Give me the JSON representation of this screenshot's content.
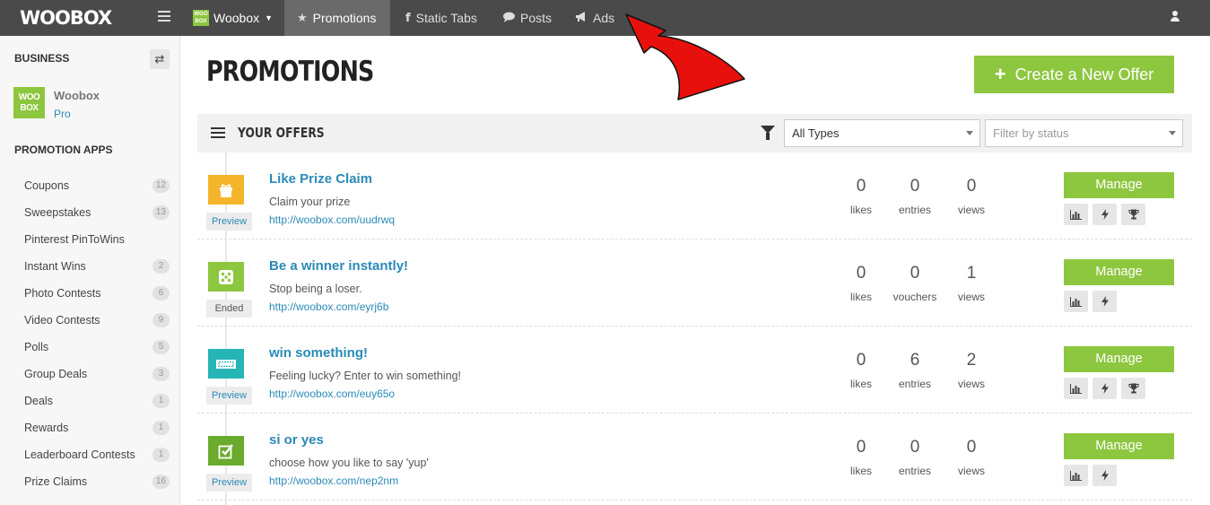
{
  "topbar": {
    "logo": "WOOBOX",
    "brand_mini": "WOO BOX",
    "brand_label": "Woobox",
    "nav": [
      {
        "label": "Promotions",
        "icon": "star-icon"
      },
      {
        "label": "Static Tabs",
        "icon": "facebook-icon"
      },
      {
        "label": "Posts",
        "icon": "speech-bubble-icon"
      },
      {
        "label": "Ads",
        "icon": "megaphone-icon"
      }
    ]
  },
  "sidebar": {
    "business_heading": "BUSINESS",
    "business_logo": "WOO BOX",
    "business_name": "Woobox",
    "business_plan": "Pro",
    "apps_heading": "PROMOTION APPS",
    "items": [
      {
        "label": "Coupons",
        "count": "12"
      },
      {
        "label": "Sweepstakes",
        "count": "13"
      },
      {
        "label": "Pinterest PinToWins",
        "count": ""
      },
      {
        "label": "Instant Wins",
        "count": "2"
      },
      {
        "label": "Photo Contests",
        "count": "6"
      },
      {
        "label": "Video Contests",
        "count": "9"
      },
      {
        "label": "Polls",
        "count": "5"
      },
      {
        "label": "Group Deals",
        "count": "3"
      },
      {
        "label": "Deals",
        "count": "1"
      },
      {
        "label": "Rewards",
        "count": "1"
      },
      {
        "label": "Leaderboard Contests",
        "count": "1"
      },
      {
        "label": "Prize Claims",
        "count": "16"
      }
    ]
  },
  "main": {
    "title": "PROMOTIONS",
    "create_button": "Create a New Offer",
    "offers_heading": "YOUR OFFERS",
    "type_select": "All Types",
    "status_placeholder": "Filter by status"
  },
  "offers": [
    {
      "title": "Like Prize Claim",
      "desc": "Claim your prize",
      "link": "http://woobox.com/uudrwq",
      "status": "Preview",
      "icon": "gift-icon",
      "color": "#f5b52a",
      "stats": [
        {
          "num": "0",
          "lbl": "likes"
        },
        {
          "num": "0",
          "lbl": "entries"
        },
        {
          "num": "0",
          "lbl": "views"
        }
      ],
      "manage": "Manage"
    },
    {
      "title": "Be a winner instantly!",
      "desc": "Stop being a loser.",
      "link": "http://woobox.com/eyrj6b",
      "status": "Ended",
      "icon": "dice-icon",
      "color": "#8dc63f",
      "stats": [
        {
          "num": "0",
          "lbl": "likes"
        },
        {
          "num": "0",
          "lbl": "vouchers"
        },
        {
          "num": "1",
          "lbl": "views"
        }
      ],
      "manage": "Manage"
    },
    {
      "title": "win something!",
      "desc": "Feeling lucky? Enter to win something!",
      "link": "http://woobox.com/euy65o",
      "status": "Preview",
      "icon": "ticket-icon",
      "color": "#26b5b5",
      "stats": [
        {
          "num": "0",
          "lbl": "likes"
        },
        {
          "num": "6",
          "lbl": "entries"
        },
        {
          "num": "2",
          "lbl": "views"
        }
      ],
      "manage": "Manage"
    },
    {
      "title": "si or yes",
      "desc": "choose how you like to say 'yup'",
      "link": "http://woobox.com/nep2nm",
      "status": "Preview",
      "icon": "checkbox-icon",
      "color": "#6aab2e",
      "stats": [
        {
          "num": "0",
          "lbl": "likes"
        },
        {
          "num": "0",
          "lbl": "entries"
        },
        {
          "num": "0",
          "lbl": "views"
        }
      ],
      "manage": "Manage"
    }
  ],
  "colors": {
    "accent": "#8dc63f",
    "link": "#2a8ab8",
    "topbar": "#4a4a4a",
    "arrow": "#e8100c"
  }
}
